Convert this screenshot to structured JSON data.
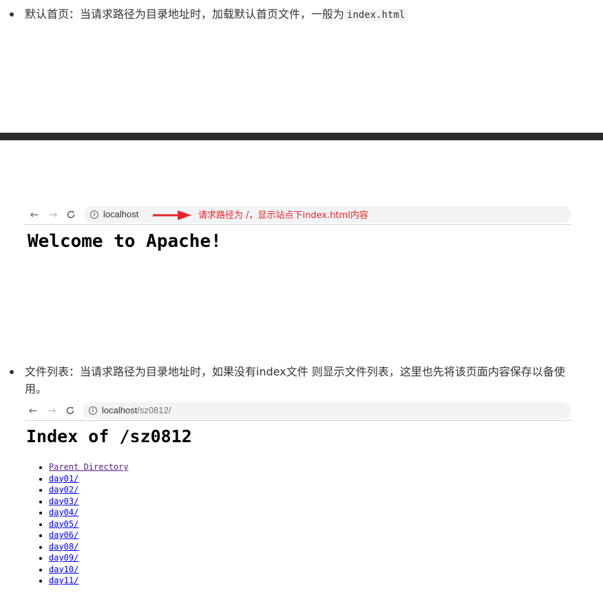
{
  "section1": {
    "text": "默认首页：当请求路径为目录地址时，加载默认首页文件，一般为",
    "code": "index.html"
  },
  "browser1": {
    "nav": {
      "back": "←",
      "forward": "→",
      "reload": "C"
    },
    "info_icon": "i",
    "url_host": "localhost",
    "url_path": "",
    "annotation": "请求路径为 /，显示站点下index.html内容",
    "annotation_color": "#e8242b"
  },
  "apache_page": {
    "heading": "Welcome to Apache!"
  },
  "section2": {
    "text": "文件列表：当请求路径为目录地址时，如果没有index文件 则显示文件列表，这里也先将该页面内容保存以备使用。"
  },
  "browser2": {
    "nav": {
      "back": "←",
      "forward": "→",
      "reload": "C"
    },
    "info_icon": "i",
    "url_host": "localhost",
    "url_path": "/sz0812/"
  },
  "index_page": {
    "heading": "Index of /sz0812",
    "items": [
      "Parent Directory",
      "day01/",
      "day02/",
      "day03/",
      "day04/",
      "day05/",
      "day06/",
      "day08/",
      "day09/",
      "day10/",
      "day11/"
    ]
  }
}
